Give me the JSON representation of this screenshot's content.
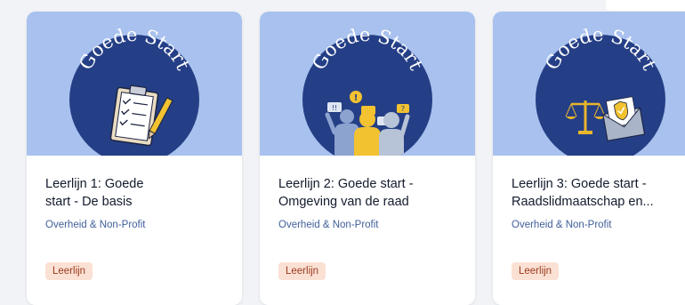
{
  "cards": [
    {
      "image_title": "Goede Start",
      "title_line1": "Leerlijn 1: Goede",
      "title_line2": "start - De basis",
      "category": "Overheid & Non-Profit",
      "badge": "Leerlijn",
      "illustration": "clipboard-checklist-icon"
    },
    {
      "image_title": "Goede Start",
      "title_line1": "Leerlijn 2: Goede start -",
      "title_line2": "Omgeving van de raad",
      "category": "Overheid & Non-Profit",
      "badge": "Leerlijn",
      "illustration": "people-discussion-icon"
    },
    {
      "image_title": "Goede Start",
      "title_line1": "Leerlijn 3: Goede start -",
      "title_line2": "Raadslidmaatschap en...",
      "category": "Overheid & Non-Profit",
      "badge": "Leerlijn",
      "illustration": "scales-envelope-icon"
    }
  ],
  "colors": {
    "page_bg": "#f1f3f6",
    "thumb_bg": "#a8c1ee",
    "circle": "#253f86",
    "badge_bg": "#fbe1d4",
    "badge_text": "#9b3a1c",
    "category_text": "#40609a"
  }
}
